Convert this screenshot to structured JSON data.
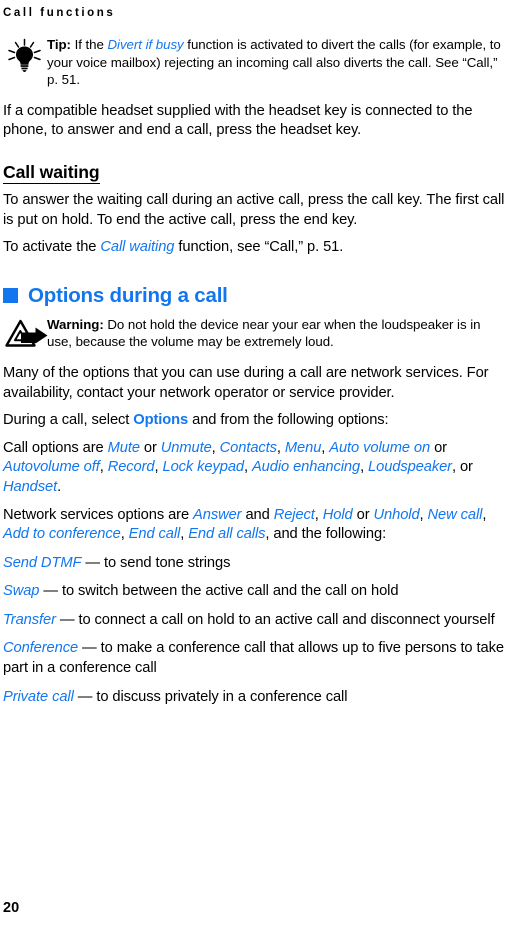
{
  "page": {
    "running_header": "Call functions",
    "folio": "20",
    "accent_color": "#1277ef",
    "text_color": "#000000",
    "background_color": "#ffffff"
  },
  "tip": {
    "icon": "lightbulb-icon",
    "label": "Tip:",
    "text_before": " If the ",
    "term": "Divert if busy",
    "text_after": " function is activated to divert the calls (for example, to your voice mailbox) rejecting an incoming call also diverts the call. See “Call,” p. 51."
  },
  "headset_paragraph": "If a compatible headset supplied with the headset key is connected to the phone, to answer and end a call, press the headset key.",
  "call_waiting": {
    "heading": "Call waiting",
    "paragraph_1": "To answer the waiting call during an active call, press the call key. The first call is put on hold. To end the active call, press the end key.",
    "paragraph_2_before": "To activate the ",
    "paragraph_2_term": "Call waiting",
    "paragraph_2_after": " function, see “Call,” p. 51."
  },
  "options_section": {
    "bullet": "square-bullet-icon",
    "heading": "Options during a call",
    "warning": {
      "icon": "warning-triangle-arrow-icon",
      "label": "Warning:",
      "text": " Do not hold the device near your ear when the loudspeaker is in use, because the volume may be extremely loud."
    },
    "network_services_note": "Many of the options that you can use during a call are network services. For availability, contact your network operator or service provider.",
    "during_call_before": "During a call, select ",
    "during_call_option": "Options",
    "during_call_after": " and from the following options:",
    "call_options": {
      "prefix": "Call options are ",
      "items": [
        "Mute",
        "Unmute",
        "Contacts",
        "Menu",
        "Auto volume on",
        "Autovolume off",
        "Record",
        "Lock keypad",
        "Audio enhancing",
        "Loudspeaker",
        "Handset"
      ],
      "separator_1": " or ",
      "separator_2": ", ",
      "separator_3": ", or ",
      "terminator": "."
    },
    "network_options": {
      "prefix": "Network services options are ",
      "items": [
        "Answer",
        "Reject",
        "Hold",
        "Unhold",
        "New call",
        "Add to conference",
        "End call",
        "End all calls"
      ],
      "suffix": ", and the following:"
    },
    "definitions": [
      {
        "term": "Send DTMF",
        "dash": " — ",
        "definition": "to send tone strings"
      },
      {
        "term": "Swap",
        "dash": " — ",
        "definition": "to switch between the active call and the call on hold"
      },
      {
        "term": "Transfer",
        "dash": " — ",
        "definition": "to connect a call on hold to an active call and disconnect yourself"
      },
      {
        "term": "Conference",
        "dash": " — ",
        "definition": "to make a conference call that allows up to five persons to take part in a conference call"
      },
      {
        "term": "Private call",
        "dash": " — ",
        "definition": "to discuss privately in a conference call"
      }
    ]
  }
}
